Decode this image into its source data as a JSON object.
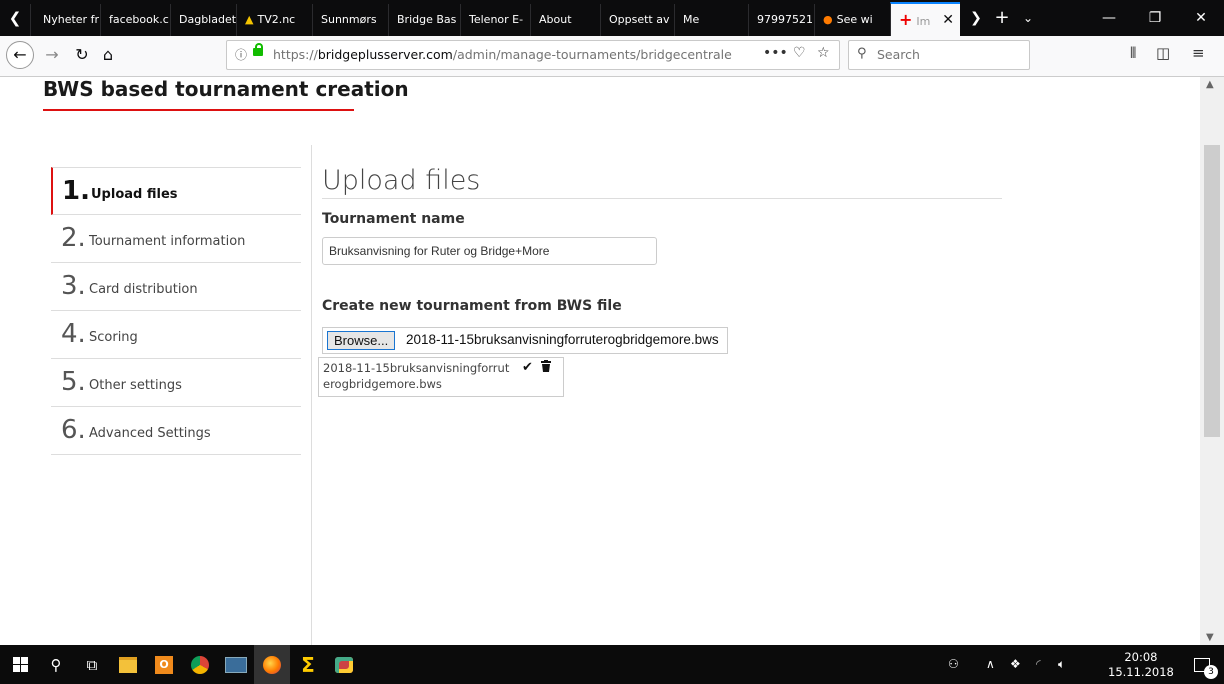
{
  "browser": {
    "tabs": [
      {
        "label": "Nyheter fr",
        "favicon": "nyheter-favicon"
      },
      {
        "label": "facebook.c",
        "favicon": "facebook-favicon"
      },
      {
        "label": "Dagbladet",
        "favicon": "dagbladet-favicon"
      },
      {
        "label": "TV2.nc",
        "favicon": "warning-icon"
      },
      {
        "label": "Sunnmørs",
        "favicon": "sunnmorsposten-favicon"
      },
      {
        "label": "Bridge Bas",
        "favicon": "bridge-favicon"
      },
      {
        "label": "Telenor E-",
        "favicon": "telenor-favicon"
      },
      {
        "label": "About",
        "favicon": "about-favicon"
      },
      {
        "label": "Oppsett av",
        "favicon": "oppsett-favicon"
      },
      {
        "label": "Me",
        "favicon": "me-favicon"
      },
      {
        "label": "97997521",
        "favicon": "number-favicon"
      },
      {
        "label": "See wi",
        "favicon": "firefox-favicon"
      },
      {
        "label": "Im",
        "favicon": "red-cross-favicon"
      }
    ],
    "url_prefix": "https://",
    "url_domain": "bridgeplusserver.com",
    "url_path": "/admin/manage-tournaments/bridgecentralen-im",
    "search_placeholder": "Search"
  },
  "page": {
    "title": "BWS based tournament creation",
    "steps": [
      {
        "num": "1.",
        "label": "Upload files"
      },
      {
        "num": "2.",
        "label": "Tournament information"
      },
      {
        "num": "3.",
        "label": "Card distribution"
      },
      {
        "num": "4.",
        "label": "Scoring"
      },
      {
        "num": "5.",
        "label": "Other settings"
      },
      {
        "num": "6.",
        "label": "Advanced Settings"
      }
    ],
    "main_heading": "Upload files",
    "tournament_name_label": "Tournament name",
    "tournament_name_value": "Bruksanvisning for Ruter og Bridge+More",
    "create_label": "Create new tournament from BWS file",
    "browse_label": "Browse...",
    "selected_file": "2018-11-15bruksanvisningforruterogbridgemore.bws",
    "uploaded_file": "2018-11-15bruksanvisningforruterogbridgemore.bws"
  },
  "taskbar": {
    "time": "20:08",
    "date": "15.11.2018",
    "notification_count": "3"
  },
  "colors": {
    "accent_red": "#dd1111",
    "tab_highlight": "#0a84ff",
    "lock_green": "#12bc00"
  }
}
